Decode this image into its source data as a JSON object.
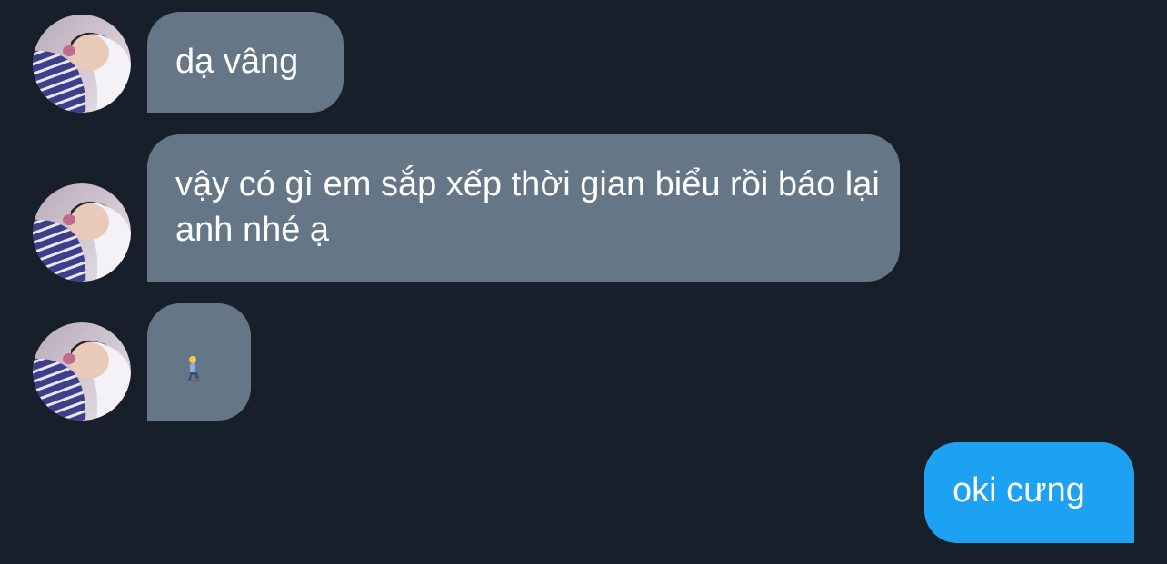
{
  "conversation": {
    "messages": [
      {
        "direction": "incoming",
        "text": "dạ vâng",
        "avatar_icon": "user-avatar-icon"
      },
      {
        "direction": "incoming",
        "text": "vậy có gì em sắp xếp thời gian biểu rồi báo lại anh nhé ạ",
        "avatar_icon": "user-avatar-icon"
      },
      {
        "direction": "incoming",
        "emoji_icon": "person-kneeling-emoji-icon",
        "avatar_icon": "user-avatar-icon"
      },
      {
        "direction": "outgoing",
        "text": "oki cưng"
      }
    ]
  },
  "colors": {
    "background": "#17202a",
    "incoming_bubble": "#657786",
    "outgoing_bubble": "#1da1f2",
    "text": "#ffffff"
  }
}
